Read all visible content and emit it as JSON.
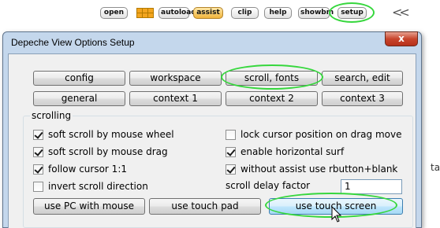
{
  "toolbar": {
    "buttons": [
      "open",
      "autoload",
      "assist",
      "clip",
      "help",
      "showbm",
      "setup"
    ],
    "grid_icon": "grid-icon",
    "back_icon": "double-chevron-left-icon"
  },
  "dialog": {
    "title": "Depeche View Options Setup",
    "close_label": "x",
    "tabs_row1": [
      "config",
      "workspace",
      "scroll, fonts",
      "search, edit"
    ],
    "tabs_row2": [
      "general",
      "context 1",
      "context 2",
      "context 3"
    ],
    "group_label": "scrolling",
    "options_left": [
      {
        "label": "soft scroll by mouse wheel",
        "checked": true
      },
      {
        "label": "soft scroll by mouse drag",
        "checked": true
      },
      {
        "label": "follow cursor 1:1",
        "checked": true
      },
      {
        "label": "invert scroll direction",
        "checked": false
      }
    ],
    "options_right": [
      {
        "label": "lock cursor position on drag move",
        "checked": false
      },
      {
        "label": "enable horizontal surf",
        "checked": true
      },
      {
        "label": "without assist use rbutton+blank",
        "checked": true
      }
    ],
    "delay_label": "scroll delay factor",
    "delay_value": "1",
    "presets": [
      "use PC with mouse",
      "use touch pad",
      "use touch screen"
    ]
  },
  "colors": {
    "highlight": "#36d73d",
    "window_frame": "#c4d7ec",
    "close_button": "#c8452c"
  },
  "background_fragment": "ta"
}
